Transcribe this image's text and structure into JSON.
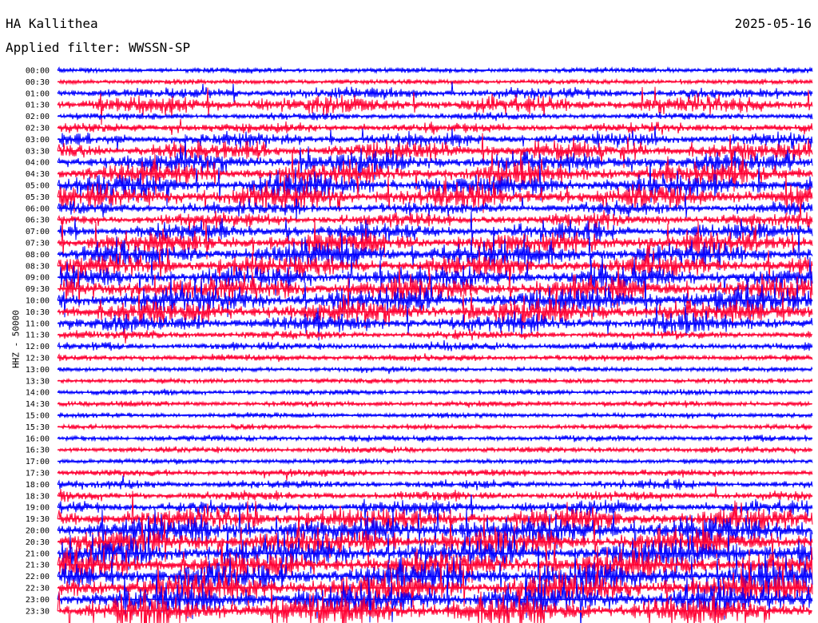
{
  "header": {
    "station": "HA Kallithea",
    "date": "2025-05-16",
    "filter_label": "Applied filter: WWSSN-SP"
  },
  "chart_data": {
    "type": "line",
    "title": "HA Kallithea",
    "subtitle": "Applied filter: WWSSN-SP",
    "ylabel": "HHZ - 50000",
    "xlabel": "",
    "colors": [
      "#0000ff",
      "#ff0033"
    ],
    "categories": [
      "00:00",
      "00:30",
      "01:00",
      "01:30",
      "02:00",
      "02:30",
      "03:00",
      "03:30",
      "04:00",
      "04:30",
      "05:00",
      "05:30",
      "06:00",
      "06:30",
      "07:00",
      "07:30",
      "08:00",
      "08:30",
      "09:00",
      "09:30",
      "10:00",
      "10:30",
      "11:00",
      "11:30",
      "12:00",
      "12:30",
      "13:00",
      "13:30",
      "14:00",
      "14:30",
      "15:00",
      "15:30",
      "16:00",
      "16:30",
      "17:00",
      "17:30",
      "18:00",
      "18:30",
      "19:00",
      "19:30",
      "20:00",
      "20:30",
      "21:00",
      "21:30",
      "22:00",
      "22:30",
      "23:00",
      "23:30"
    ],
    "activity_level": [
      0.4,
      0.3,
      1.2,
      2.2,
      0.6,
      1.0,
      1.6,
      2.4,
      2.6,
      2.8,
      3.0,
      3.2,
      1.4,
      1.6,
      2.0,
      3.0,
      3.2,
      2.8,
      2.6,
      3.4,
      3.4,
      3.2,
      2.2,
      0.8,
      0.8,
      0.5,
      0.3,
      0.3,
      0.4,
      0.4,
      0.3,
      0.3,
      0.5,
      0.5,
      0.3,
      0.6,
      0.8,
      1.0,
      1.6,
      3.0,
      3.6,
      3.6,
      3.8,
      3.8,
      3.8,
      4.0,
      4.0,
      4.0
    ]
  }
}
